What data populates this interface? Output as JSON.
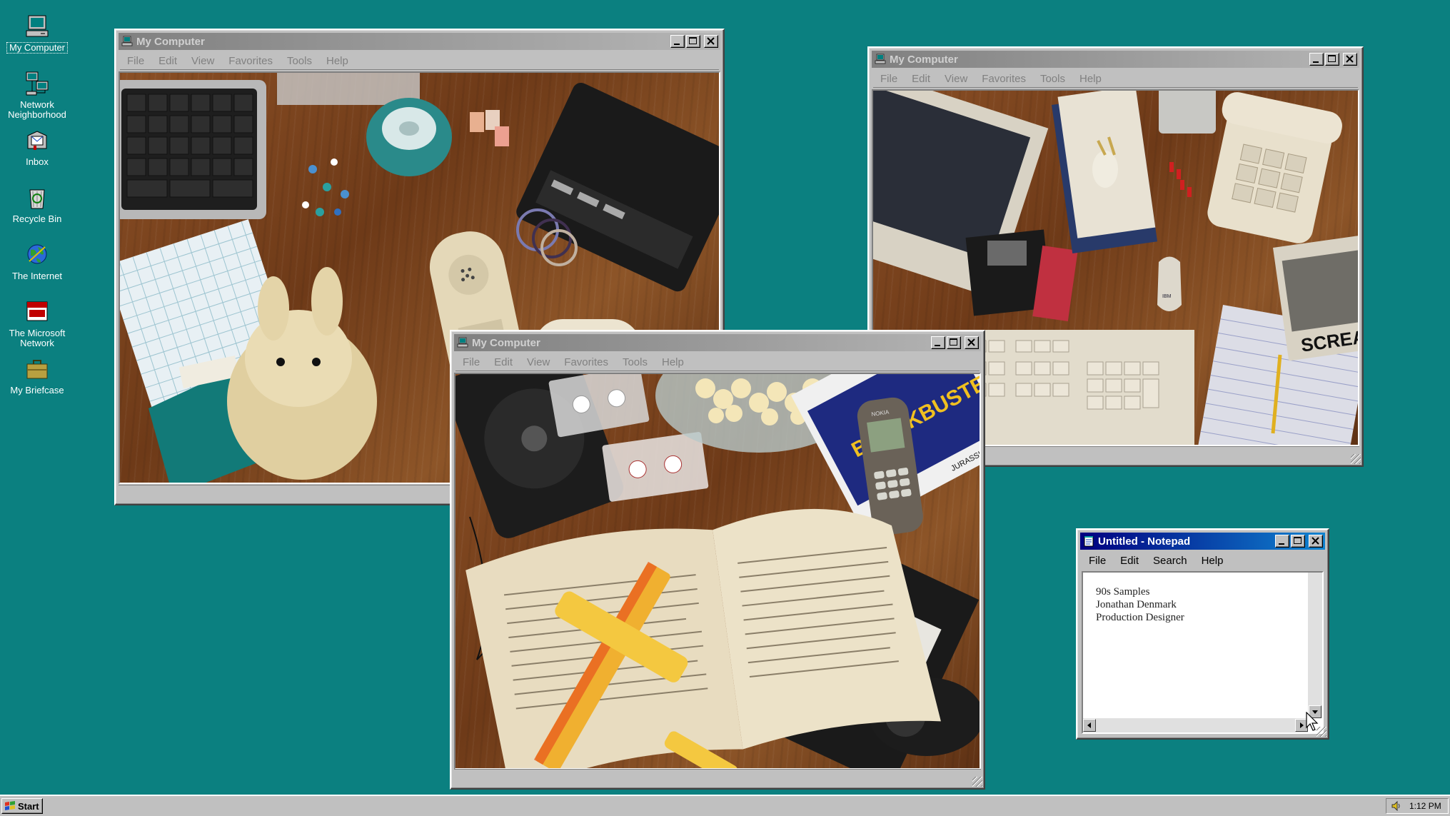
{
  "desktop": {
    "icons": [
      {
        "label": "My Computer",
        "icon": "my-computer-icon"
      },
      {
        "label": "Network Neighborhood",
        "icon": "network-neighborhood-icon"
      },
      {
        "label": "Inbox",
        "icon": "inbox-icon"
      },
      {
        "label": "Recycle Bin",
        "icon": "recycle-bin-icon"
      },
      {
        "label": "The Internet",
        "icon": "internet-icon"
      },
      {
        "label": "The Microsoft Network",
        "icon": "msn-icon"
      },
      {
        "label": "My Briefcase",
        "icon": "briefcase-icon"
      }
    ],
    "background": "#0b8080"
  },
  "windows": {
    "left": {
      "title": "My Computer",
      "menu": [
        "File",
        "Edit",
        "View",
        "Favorites",
        "Tools",
        "Help"
      ]
    },
    "right": {
      "title": "My Computer",
      "menu": [
        "File",
        "Edit",
        "View",
        "Favorites",
        "Tools",
        "Help"
      ]
    },
    "center": {
      "title": "My Computer",
      "menu": [
        "File",
        "Edit",
        "View",
        "Favorites",
        "Tools",
        "Help"
      ]
    }
  },
  "notepad": {
    "title": "Untitled - Notepad",
    "menu": [
      "File",
      "Edit",
      "Search",
      "Help"
    ],
    "lines": [
      "90s Samples",
      "Jonathan Denmark",
      "Production Designer"
    ]
  },
  "photos": {
    "center_tape_label": "BLOCKBUSTER",
    "center_tape_sub": "JURASSIC PARK",
    "center_phone_brand": "NOKIA",
    "right_magazine": "SCREAM",
    "right_mouse_brand": "IBM"
  },
  "taskbar": {
    "start_label": "Start",
    "clock": "1:12 PM"
  }
}
